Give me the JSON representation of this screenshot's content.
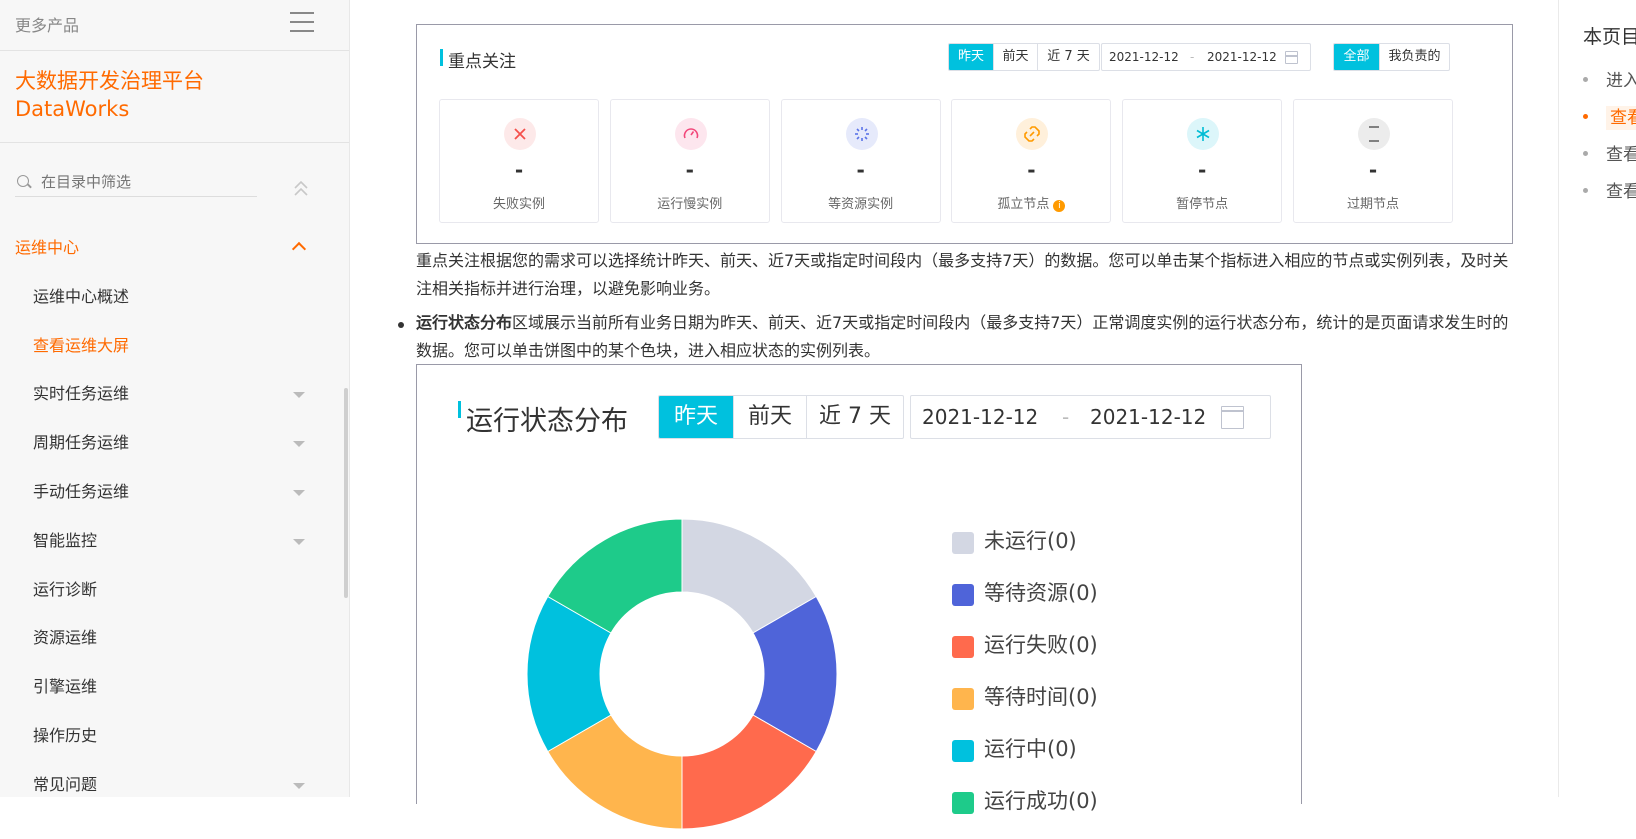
{
  "sidebar": {
    "more_products": "更多产品",
    "brand_line1": "大数据开发治理平台",
    "brand_line2": "DataWorks",
    "filter_placeholder": "在目录中筛选",
    "section": "运维中心",
    "items": [
      {
        "label": "运维中心概述",
        "expandable": false,
        "active": false
      },
      {
        "label": "查看运维大屏",
        "expandable": false,
        "active": true
      },
      {
        "label": "实时任务运维",
        "expandable": true,
        "active": false
      },
      {
        "label": "周期任务运维",
        "expandable": true,
        "active": false
      },
      {
        "label": "手动任务运维",
        "expandable": true,
        "active": false
      },
      {
        "label": "智能监控",
        "expandable": true,
        "active": false
      },
      {
        "label": "运行诊断",
        "expandable": false,
        "active": false
      },
      {
        "label": "资源运维",
        "expandable": false,
        "active": false
      },
      {
        "label": "引擎运维",
        "expandable": false,
        "active": false
      },
      {
        "label": "操作历史",
        "expandable": false,
        "active": false
      },
      {
        "label": "常见问题",
        "expandable": true,
        "active": false
      }
    ]
  },
  "focus": {
    "title": "重点关注",
    "ranges": [
      "昨天",
      "前天",
      "近 7 天"
    ],
    "selected_range": "昨天",
    "date_start": "2021-12-12",
    "date_sep": "-",
    "date_end": "2021-12-12",
    "scopes": [
      "全部",
      "我负责的"
    ],
    "selected_scope": "全部",
    "kpis": [
      {
        "label": "失败实例",
        "value": "-",
        "icon": "close-icon",
        "color": "#f5504c",
        "bg": "#fde9e9"
      },
      {
        "label": "运行慢实例",
        "value": "-",
        "icon": "speedometer-icon",
        "color": "#f2477a",
        "bg": "#fde6ee"
      },
      {
        "label": "等资源实例",
        "value": "-",
        "icon": "loading-icon",
        "color": "#5b73e8",
        "bg": "#e6eafb"
      },
      {
        "label": "孤立节点",
        "value": "-",
        "icon": "broken-link-icon",
        "color": "#ff9a00",
        "bg": "#fff0db"
      },
      {
        "label": "暂停节点",
        "value": "-",
        "icon": "snowflake-icon",
        "color": "#00bcd4",
        "bg": "#dcf6fa"
      },
      {
        "label": "过期节点",
        "value": "-",
        "icon": "hourglass-icon",
        "color": "#666666",
        "bg": "#ececec"
      }
    ]
  },
  "text": {
    "focus_desc": "重点关注根据您的需求可以选择统计昨天、前天、近7天或指定时间段内（最多支持7天）的数据。您可以单击某个指标进入相应的节点或实例列表，及时关注相关指标并进行治理，以避免影响业务。",
    "status_bold": "运行状态分布",
    "status_desc": "区域展示当前所有业务日期为昨天、前天、近7天或指定时间段内（最多支持7天）正常调度实例的运行状态分布，统计的是页面请求发生时的数据。您可以单击饼图中的某个色块，进入相应状态的实例列表。"
  },
  "status": {
    "title": "运行状态分布",
    "ranges": [
      "昨天",
      "前天",
      "近 7 天"
    ],
    "selected_range": "昨天",
    "date_start": "2021-12-12",
    "date_sep": "-",
    "date_end": "2021-12-12"
  },
  "chart_data": {
    "type": "pie",
    "donut": true,
    "slices": [
      {
        "name": "未运行(0)",
        "value": 1,
        "color": "#d3d7e3"
      },
      {
        "name": "等待资源(0)",
        "value": 1,
        "color": "#4f64d9"
      },
      {
        "name": "运行失败(0)",
        "value": 1,
        "color": "#ff6a4d"
      },
      {
        "name": "等待时间(0)",
        "value": 1,
        "color": "#ffb54d"
      },
      {
        "name": "运行中(0)",
        "value": 1,
        "color": "#00c1de"
      },
      {
        "name": "运行成功(0)",
        "value": 1,
        "color": "#1ecb8a"
      }
    ]
  },
  "toc": {
    "title": "本页目录",
    "items": [
      {
        "label": "进入运维大屏",
        "active": false
      },
      {
        "label": "查看运维大屏",
        "active": true
      },
      {
        "label": "查看调度资源",
        "active": false
      },
      {
        "label": "查看任务运行",
        "active": false
      }
    ]
  }
}
